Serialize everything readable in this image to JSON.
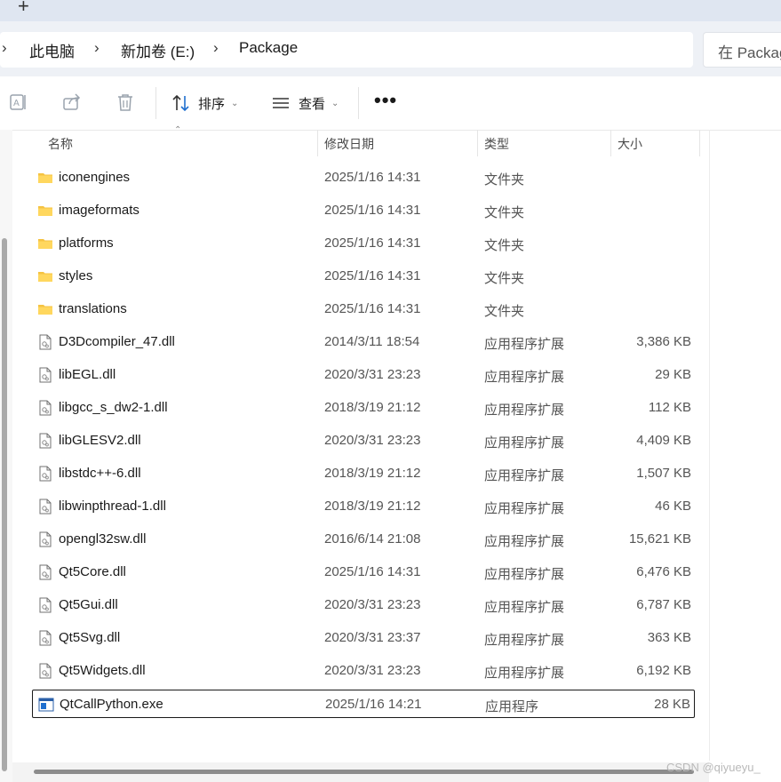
{
  "tabbar": {
    "new_tab_label": "+"
  },
  "breadcrumb": {
    "items": [
      "此电脑",
      "新加卷 (E:)",
      "Package"
    ],
    "separator": "›"
  },
  "search": {
    "placeholder": "在 Package"
  },
  "toolbar": {
    "sort_label": "排序",
    "view_label": "查看",
    "more_label": "•••"
  },
  "columns": {
    "name": "名称",
    "date": "修改日期",
    "type": "类型",
    "size": "大小"
  },
  "files": [
    {
      "icon": "folder-icon",
      "name": "iconengines",
      "date": "2025/1/16 14:31",
      "type": "文件夹",
      "size": ""
    },
    {
      "icon": "folder-icon",
      "name": "imageformats",
      "date": "2025/1/16 14:31",
      "type": "文件夹",
      "size": ""
    },
    {
      "icon": "folder-icon",
      "name": "platforms",
      "date": "2025/1/16 14:31",
      "type": "文件夹",
      "size": ""
    },
    {
      "icon": "folder-icon",
      "name": "styles",
      "date": "2025/1/16 14:31",
      "type": "文件夹",
      "size": ""
    },
    {
      "icon": "folder-icon",
      "name": "translations",
      "date": "2025/1/16 14:31",
      "type": "文件夹",
      "size": ""
    },
    {
      "icon": "dll-icon",
      "name": "D3Dcompiler_47.dll",
      "date": "2014/3/11 18:54",
      "type": "应用程序扩展",
      "size": "3,386 KB"
    },
    {
      "icon": "dll-icon",
      "name": "libEGL.dll",
      "date": "2020/3/31 23:23",
      "type": "应用程序扩展",
      "size": "29 KB"
    },
    {
      "icon": "dll-icon",
      "name": "libgcc_s_dw2-1.dll",
      "date": "2018/3/19 21:12",
      "type": "应用程序扩展",
      "size": "112 KB"
    },
    {
      "icon": "dll-icon",
      "name": "libGLESV2.dll",
      "date": "2020/3/31 23:23",
      "type": "应用程序扩展",
      "size": "4,409 KB"
    },
    {
      "icon": "dll-icon",
      "name": "libstdc++-6.dll",
      "date": "2018/3/19 21:12",
      "type": "应用程序扩展",
      "size": "1,507 KB"
    },
    {
      "icon": "dll-icon",
      "name": "libwinpthread-1.dll",
      "date": "2018/3/19 21:12",
      "type": "应用程序扩展",
      "size": "46 KB"
    },
    {
      "icon": "dll-icon",
      "name": "opengl32sw.dll",
      "date": "2016/6/14 21:08",
      "type": "应用程序扩展",
      "size": "15,621 KB"
    },
    {
      "icon": "dll-icon",
      "name": "Qt5Core.dll",
      "date": "2025/1/16 14:31",
      "type": "应用程序扩展",
      "size": "6,476 KB"
    },
    {
      "icon": "dll-icon",
      "name": "Qt5Gui.dll",
      "date": "2020/3/31 23:23",
      "type": "应用程序扩展",
      "size": "6,787 KB"
    },
    {
      "icon": "dll-icon",
      "name": "Qt5Svg.dll",
      "date": "2020/3/31 23:37",
      "type": "应用程序扩展",
      "size": "363 KB"
    },
    {
      "icon": "dll-icon",
      "name": "Qt5Widgets.dll",
      "date": "2020/3/31 23:23",
      "type": "应用程序扩展",
      "size": "6,192 KB"
    },
    {
      "icon": "exe-icon",
      "name": "QtCallPython.exe",
      "date": "2025/1/16 14:21",
      "type": "应用程序",
      "size": "28 KB",
      "selected": true
    }
  ],
  "watermark": "CSDN @qiyueyu_",
  "colors": {
    "folder": "#f5c342",
    "selection_border": "#1a1a1a",
    "exe_blue": "#1f6fcf"
  }
}
